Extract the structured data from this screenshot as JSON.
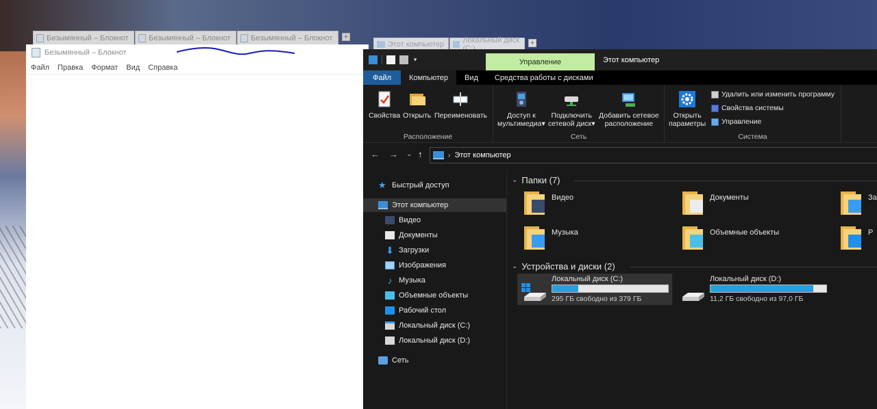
{
  "notepad": {
    "tabs": [
      "Безымянный – Блокнот",
      "Безымянный – Блокнот",
      "Безымянный – Блокнот"
    ],
    "tab_add": "+",
    "title": "Безымянный – Блокнот",
    "menu": [
      "Файл",
      "Правка",
      "Формат",
      "Вид",
      "Справка"
    ]
  },
  "explorer_tabs": {
    "tabs": [
      "Этот компьютер",
      "Локальный диск (C:)"
    ],
    "tab_add": "+"
  },
  "explorer": {
    "quick_access_arrow": "▾",
    "manage_tab": "Управление",
    "window_title": "Этот компьютер",
    "ribbon_tabs": {
      "file": "Файл",
      "computer": "Компьютер",
      "view": "Вид",
      "disk_tools": "Средства работы с дисками"
    },
    "ribbon": {
      "location": {
        "label": "Расположение",
        "properties": "Свойства",
        "open": "Открыть",
        "rename": "Переименовать"
      },
      "network": {
        "label": "Сеть",
        "media_line1": "Доступ к",
        "media_line2": "мультимедиа",
        "map_line1": "Подключить",
        "map_line2": "сетевой диск",
        "add_line1": "Добавить сетевое",
        "add_line2": "расположение",
        "dropdown_arrow": "▾"
      },
      "system": {
        "label": "Система",
        "settings_line1": "Открыть",
        "settings_line2": "параметры",
        "uninstall": "Удалить или изменить программу",
        "sys_props": "Свойства системы",
        "manage": "Управление"
      }
    },
    "address": {
      "back": "←",
      "forward": "→",
      "recent": "⌄",
      "up": "↑",
      "separator": "›",
      "path": "Этот компьютер"
    },
    "nav": {
      "quick_access": "Быстрый доступ",
      "this_pc": "Этот компьютер",
      "video": "Видео",
      "documents": "Документы",
      "downloads": "Загрузки",
      "pictures": "Изображения",
      "music": "Музыка",
      "objects3d": "Объемные объекты",
      "desktop": "Рабочий стол",
      "disk_c": "Локальный диск (C:)",
      "disk_d": "Локальный диск (D:)",
      "network": "Сеть"
    },
    "folders": {
      "heading": "Папки (7)",
      "collapse": "⌄",
      "items": [
        "Видео",
        "Документы",
        "За",
        "Музыка",
        "Объемные объекты",
        "Р"
      ]
    },
    "devices": {
      "heading": "Устройства и диски (2)",
      "collapse": "⌄",
      "drives": [
        {
          "name": "Локальный диск (C:)",
          "free": "295 ГБ свободно из 379 ГБ",
          "used_fraction": 0.222
        },
        {
          "name": "Локальный диск (D:)",
          "free": "11,2 ГБ свободно из 97,0 ГБ",
          "used_fraction": 0.885
        }
      ]
    },
    "colors": {
      "file_tab": "#1f5c99",
      "manage_tab": "#c3eca3",
      "drive_bar": "#26a0da",
      "folder": "#f6d27a"
    }
  }
}
